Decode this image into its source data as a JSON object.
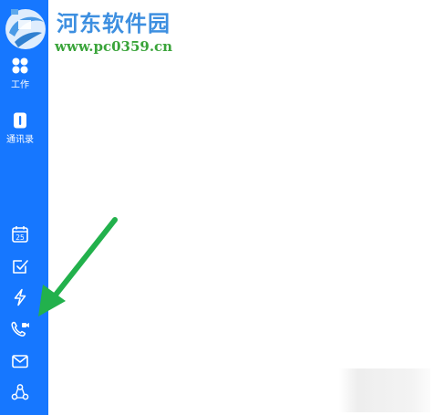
{
  "watermark": {
    "title": "河东软件园",
    "url": "www.pc0359.cn"
  },
  "sidebar": {
    "items": [
      {
        "label": "工作",
        "icon": "workspace-grid-icon"
      },
      {
        "label": "通讯录",
        "icon": "contacts-book-icon"
      },
      {
        "label": "",
        "icon": "calendar-icon",
        "calendar_day": "25"
      },
      {
        "label": "",
        "icon": "todo-check-icon"
      },
      {
        "label": "",
        "icon": "lightning-icon"
      },
      {
        "label": "",
        "icon": "phone-video-call-icon"
      },
      {
        "label": "",
        "icon": "mail-icon"
      },
      {
        "label": "",
        "icon": "more-apps-icon"
      }
    ]
  },
  "colors": {
    "sidebar": "#1677ff",
    "arrow": "#22b14c",
    "watermark_title": "#3d8fe0",
    "watermark_url": "#3aa43a"
  }
}
